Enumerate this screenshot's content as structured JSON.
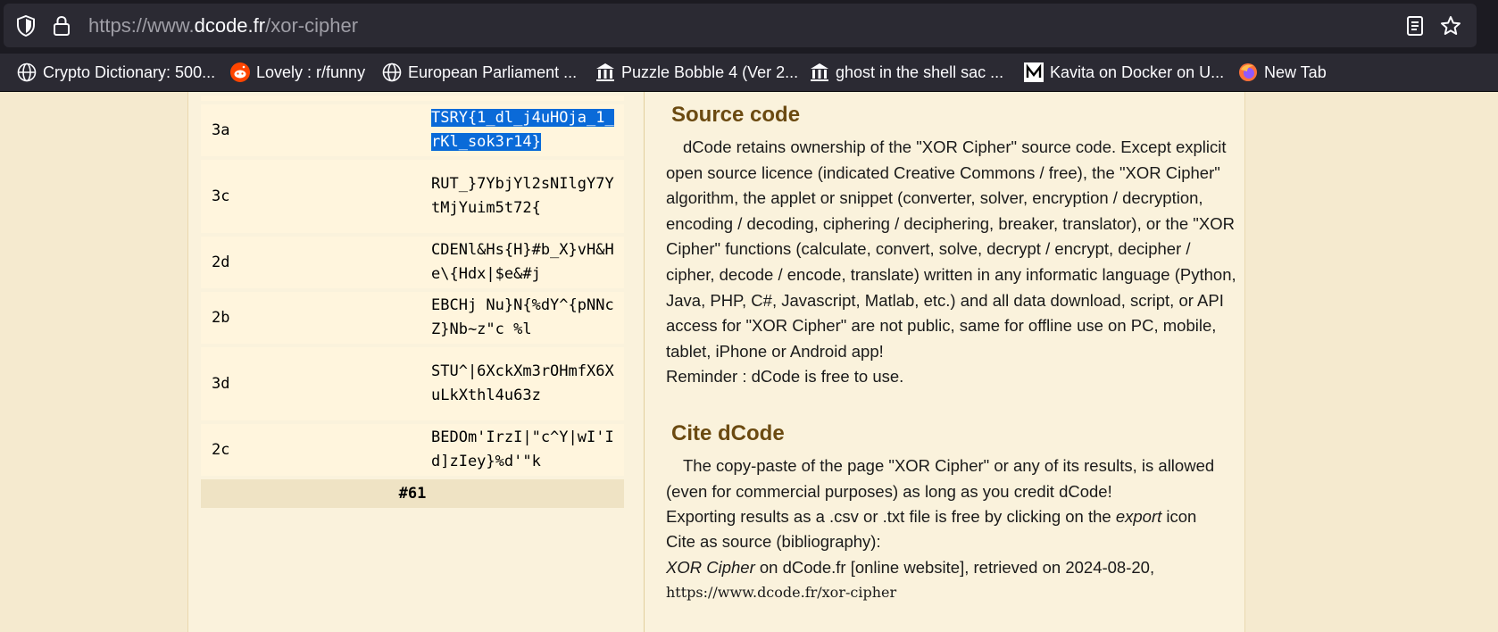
{
  "browser": {
    "url_prefix": "https://www.",
    "url_host": "dcode.fr",
    "url_path": "/xor-cipher",
    "bookmarks": [
      {
        "label": "Crypto Dictionary: 500...",
        "icon": "globe-icon"
      },
      {
        "label": "Lovely : r/funny",
        "icon": "reddit-icon"
      },
      {
        "label": "European Parliament ...",
        "icon": "globe-icon"
      },
      {
        "label": "Puzzle Bobble 4 (Ver 2...",
        "icon": "museum-icon"
      },
      {
        "label": "ghost in the shell sac ...",
        "icon": "museum-icon"
      },
      {
        "label": "Kavita on Docker on U...",
        "icon": "medium-icon"
      },
      {
        "label": "New Tab",
        "icon": "firefox-icon"
      }
    ]
  },
  "results": {
    "rows": [
      {
        "key": "3a",
        "value": "TSRY{1_dl_j4uHOja_1_rKl_sok3r14}",
        "selected": true
      },
      {
        "key": "3c",
        "value": "RUT_}7YbjYl2sNIlgY7YtMjYuim5t72{",
        "selected": false
      },
      {
        "key": "2d",
        "value": "CDENl&Hs{H}#b_X}vH&He\\{Hdx|$e&#j",
        "selected": false
      },
      {
        "key": "2b",
        "value": "EBCHj Nu}N{%dY^{pNNcZ}Nb~z\"c %l",
        "selected": false
      },
      {
        "key": "3d",
        "value": "STU^|6XckXm3rOHmfX6XuLkXthl4u63z",
        "selected": false
      },
      {
        "key": "2c",
        "value": "BEDOm'IrzI|\"c^Y|wI'Id]zIey}%d'\"k",
        "selected": false
      }
    ],
    "footer": "#61"
  },
  "source_code": {
    "heading": "Source code",
    "body": "dCode retains ownership of the \"XOR Cipher\" source code. Except explicit open source licence (indicated Creative Commons / free), the \"XOR Cipher\" algorithm, the applet or snippet (converter, solver, encryption / decryption, encoding / decoding, ciphering / deciphering, breaker, translator), or the \"XOR Cipher\" functions (calculate, convert, solve, decrypt / encrypt, decipher / cipher, decode / encode, translate) written in any informatic language (Python, Java, PHP, C#, Javascript, Matlab, etc.) and all data download, script, or API access for \"XOR Cipher\" are not public, same for offline use on PC, mobile, tablet, iPhone or Android app!",
    "reminder": "Reminder : dCode is free to use."
  },
  "cite": {
    "heading": "Cite dCode",
    "body": "The copy-paste of the page \"XOR Cipher\" or any of its results, is allowed (even for commercial purposes) as long as you credit dCode!",
    "export_prefix": "Exporting results as a .csv or .txt file is free by clicking on the ",
    "export_em": "export",
    "export_suffix": " icon",
    "cite_as": "Cite as source (bibliography):",
    "ref_em": "XOR Cipher",
    "ref_rest": " on dCode.fr [online website], retrieved on 2024-08-20,",
    "ref_url": "https://www.dcode.fr/xor-cipher"
  }
}
